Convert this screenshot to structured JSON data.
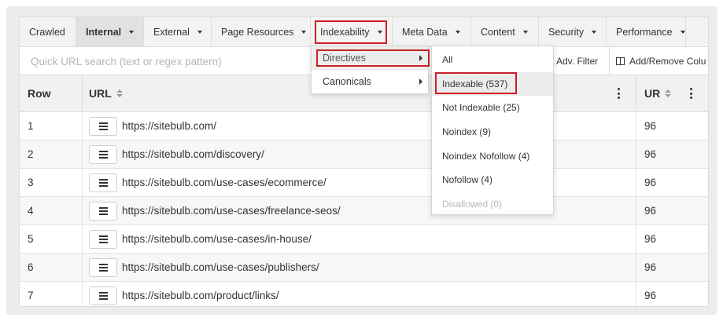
{
  "nav": {
    "tabs": [
      {
        "label": "Crawled",
        "caret": false
      },
      {
        "label": "Internal",
        "caret": true
      },
      {
        "label": "External",
        "caret": true
      },
      {
        "label": "Page Resources",
        "caret": true
      },
      {
        "label": "Indexability",
        "caret": true
      },
      {
        "label": "Meta Data",
        "caret": true
      },
      {
        "label": "Content",
        "caret": true
      },
      {
        "label": "Security",
        "caret": true
      },
      {
        "label": "Performance",
        "caret": true
      }
    ],
    "active": "Internal",
    "highlighted": "Indexability"
  },
  "search": {
    "placeholder": "Quick URL search (text or regex pattern)",
    "adv_filter_label": "Adv. Filter",
    "add_remove_columns_label": "Add/Remove Colu"
  },
  "table": {
    "columns": {
      "row": "Row",
      "url": "URL",
      "ur": "UR"
    },
    "rows": [
      {
        "row": "1",
        "url": "https://sitebulb.com/",
        "ur": "96"
      },
      {
        "row": "2",
        "url": "https://sitebulb.com/discovery/",
        "ur": "96"
      },
      {
        "row": "3",
        "url": "https://sitebulb.com/use-cases/ecommerce/",
        "ur": "96"
      },
      {
        "row": "4",
        "url": "https://sitebulb.com/use-cases/freelance-seos/",
        "ur": "96"
      },
      {
        "row": "5",
        "url": "https://sitebulb.com/use-cases/in-house/",
        "ur": "96"
      },
      {
        "row": "6",
        "url": "https://sitebulb.com/use-cases/publishers/",
        "ur": "96"
      },
      {
        "row": "7",
        "url": "https://sitebulb.com/product/links/",
        "ur": "96"
      }
    ]
  },
  "indexability_menu": {
    "items": [
      {
        "label": "Directives",
        "submenu": true,
        "selected": true
      },
      {
        "label": "Canonicals",
        "submenu": true,
        "selected": false
      }
    ]
  },
  "directives_menu": {
    "items": [
      {
        "label": "All",
        "disabled": false,
        "highlighted": false
      },
      {
        "label": "Indexable (537)",
        "disabled": false,
        "highlighted": true
      },
      {
        "label": "Not Indexable (25)",
        "disabled": false,
        "highlighted": false
      },
      {
        "label": "Noindex (9)",
        "disabled": false,
        "highlighted": false
      },
      {
        "label": "Noindex Nofollow (4)",
        "disabled": false,
        "highlighted": false
      },
      {
        "label": "Nofollow (4)",
        "disabled": false,
        "highlighted": false
      },
      {
        "label": "Disallowed (0)",
        "disabled": true,
        "highlighted": false
      }
    ]
  },
  "colors": {
    "highlight_box": "#cc1f2a",
    "nav_background": "#f3f3f3",
    "active_tab_background": "#e1e1e1"
  }
}
